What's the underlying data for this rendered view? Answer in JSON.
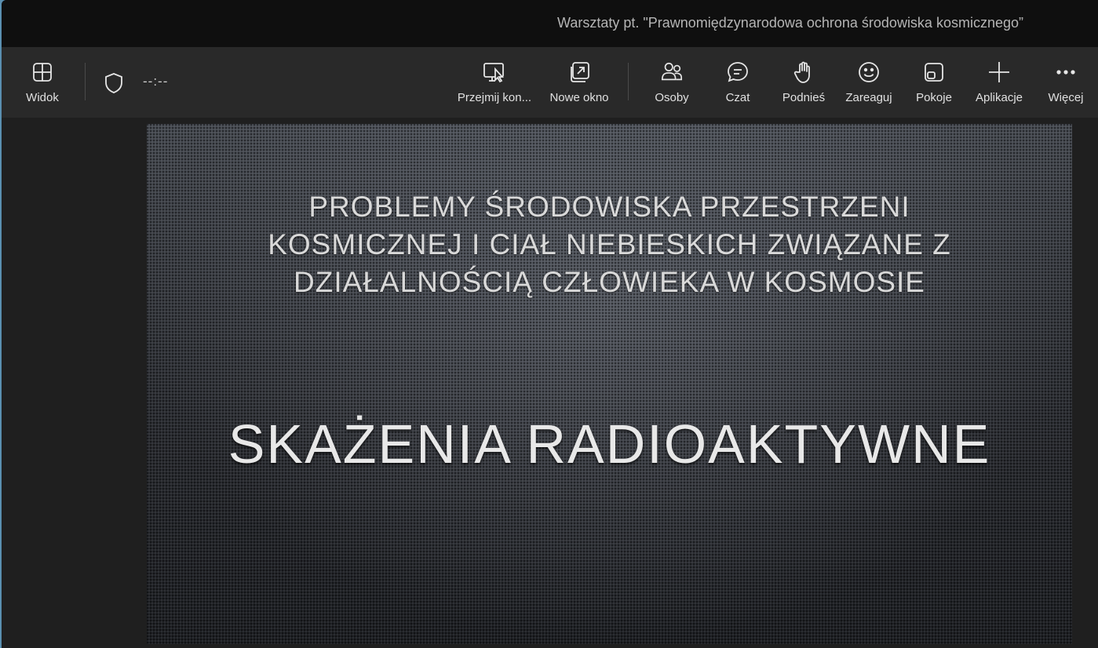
{
  "window": {
    "title": "Warsztaty pt. \"Prawnomiędzynarodowa ochrona środowiska kosmicznego”"
  },
  "toolbar": {
    "view_label": "Widok",
    "timer": "--:--",
    "buttons": [
      {
        "label": "Przejmij kon...",
        "icon": "take-control-icon"
      },
      {
        "label": "Nowe okno",
        "icon": "new-window-icon"
      },
      {
        "label": "Osoby",
        "icon": "people-icon"
      },
      {
        "label": "Czat",
        "icon": "chat-icon"
      },
      {
        "label": "Podnieś",
        "icon": "raise-hand-icon"
      },
      {
        "label": "Zareaguj",
        "icon": "react-icon"
      },
      {
        "label": "Pokoje",
        "icon": "rooms-icon"
      },
      {
        "label": "Aplikacje",
        "icon": "add-apps-icon"
      },
      {
        "label": "Więcej",
        "icon": "more-icon"
      }
    ]
  },
  "slide": {
    "title_lines": [
      "PROBLEMY ŚRODOWISKA PRZESTRZENI",
      "KOSMICZNEJ I CIAŁ NIEBIESKICH ZWIĄZANE Z",
      "DZIAŁALNOŚCIĄ CZŁOWIEKA W KOSMOSIE"
    ],
    "subtitle": "SKAŻENIA RADIOAKTYWNE"
  },
  "colors": {
    "titlebar": "#0f0f0f",
    "toolbar": "#292929",
    "stage": "#1f1f1f"
  }
}
